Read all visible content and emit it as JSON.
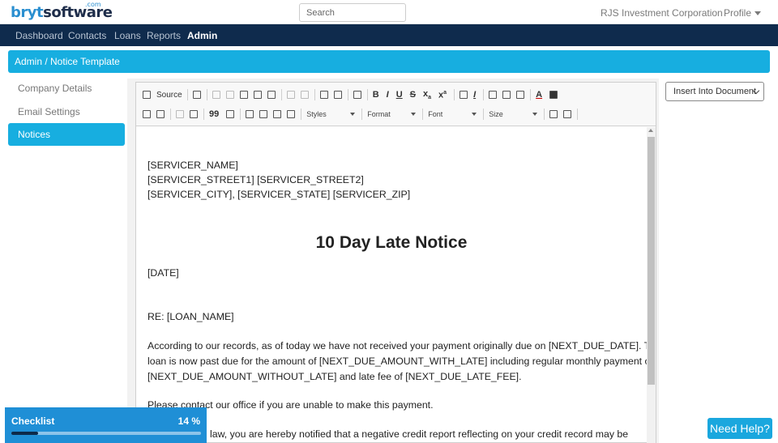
{
  "header": {
    "logo_main": "bryt",
    "logo_brand": "software",
    "logo_sup": ".com",
    "search_placeholder": "Search",
    "company": "RJS Investment Corporation",
    "profile": "Profile"
  },
  "nav": {
    "items": [
      "Dashboard",
      "Contacts",
      "Loans",
      "Reports",
      "Admin"
    ],
    "active": "Admin"
  },
  "page": {
    "title": "Admin / Notice Template"
  },
  "sidebar": {
    "items": [
      "Company Details",
      "Email Settings",
      "Notices"
    ],
    "active": "Notices"
  },
  "toolbar": {
    "source_label": "Source",
    "styles_label": "Styles",
    "format_label": "Format",
    "font_label": "Font",
    "size_label": "Size"
  },
  "document": {
    "servicer_name": "[SERVICER_NAME]",
    "servicer_street": "[SERVICER_STREET1] [SERVICER_STREET2]",
    "servicer_city": "[SERVICER_CITY], [SERVICER_STATE] [SERVICER_ZIP]",
    "heading": "10 Day Late Notice",
    "date": "[DATE]",
    "re": "RE:  [LOAN_NAME]",
    "p1_l1": "According to our records, as of today we have not received your payment originally due on [NEXT_DUE_DATE].  This",
    "p1_l2": "loan is now past due for the amount of [NEXT_DUE_AMOUNT_WITH_LATE] including regular monthly payment of",
    "p1_l3": "[NEXT_DUE_AMOUNT_WITHOUT_LATE] and late fee of [NEXT_DUE_LATE_FEE].",
    "p2": "Please contact our office if you are unable to make this payment.",
    "p3_partial": "law, you are hereby notified that a negative credit report reflecting on your credit record may be"
  },
  "insert_dropdown": {
    "selected": "Insert Into Document"
  },
  "checklist": {
    "label": "Checklist",
    "percent_label": "14 %",
    "progress": 0.14
  },
  "help": {
    "label": "Need Help?"
  },
  "colors": {
    "accent": "#17aee0",
    "nav": "#0f2b4d",
    "checklist": "#1f8fd6"
  }
}
